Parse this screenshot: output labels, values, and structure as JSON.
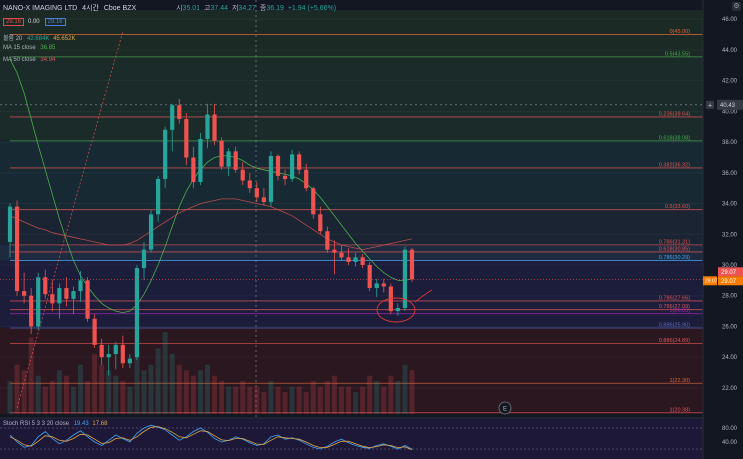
{
  "header": {
    "symbol": "NANO-X IMAGING LTD",
    "interval": "4시간",
    "exchange": "Cboe BZX",
    "ohlc": {
      "open_label": "시",
      "open": "35.01",
      "high_label": "고",
      "high": "37.44",
      "low_label": "저",
      "low": "34.27",
      "close_label": "종",
      "close": "36.19",
      "change": "+1.94 (+5.66%)"
    },
    "price_box_left": "29.16",
    "price_mid": "0.00",
    "price_box_right": "29.16"
  },
  "indicators": {
    "volume": {
      "label": "볼륨 20",
      "v1": "42.684K",
      "v2": "45.652K"
    },
    "ma15": {
      "label": "MA 15 close",
      "value": "36.85"
    },
    "ma50": {
      "label": "MA 50 close",
      "value": "34.94"
    },
    "rsi": {
      "label": "Stoch RSI 5 3 3 20 close",
      "k": "19.43",
      "d": "17.68"
    }
  },
  "axis": {
    "ticks": [
      {
        "v": 46,
        "t": "46.00"
      },
      {
        "v": 44,
        "t": "44.00"
      },
      {
        "v": 42,
        "t": "42.00"
      },
      {
        "v": 40,
        "t": "40.00"
      },
      {
        "v": 38,
        "t": "38.00"
      },
      {
        "v": 36,
        "t": "36.00"
      },
      {
        "v": 34,
        "t": "34.00"
      },
      {
        "v": 32,
        "t": "32.00"
      },
      {
        "v": 30,
        "t": "30.00"
      },
      {
        "v": 28,
        "t": "28.00"
      },
      {
        "v": 26,
        "t": "26.00"
      },
      {
        "v": 24,
        "t": "24.00"
      },
      {
        "v": 22,
        "t": "22.00"
      }
    ],
    "crosshair_label": "40.43",
    "last_price_label": "29.07",
    "last_price_sub": "29.07",
    "last_price_tag": "29.07",
    "rsi_ticks": [
      {
        "v": 80,
        "t": "80.00"
      },
      {
        "v": 40,
        "t": "40.00"
      }
    ]
  },
  "fib_levels": [
    {
      "label": "0(45.00)",
      "v": 45.0,
      "color": "#e0663c"
    },
    {
      "label": "0.5(43.55)",
      "v": 43.55,
      "color": "#4caf50"
    },
    {
      "label": "0.236(39.64)",
      "v": 39.64,
      "color": "#e05555"
    },
    {
      "label": "0.618(38.08)",
      "v": 38.08,
      "color": "#4caf50"
    },
    {
      "label": "0.382(36.32)",
      "v": 36.32,
      "color": "#e05555"
    },
    {
      "label": "0.5(33.60)",
      "v": 33.6,
      "color": "#e05555"
    },
    {
      "label": "0.786(31.31)",
      "v": 31.31,
      "color": "#e05555"
    },
    {
      "label": "0.618(30.85)",
      "v": 30.85,
      "color": "#e05555"
    },
    {
      "label": "0.786(30.29)",
      "v": 30.29,
      "color": "#42a5f5"
    },
    {
      "label": "0.786(27.66)",
      "v": 27.66,
      "color": "#e05555"
    },
    {
      "label": "0.786(27.09)",
      "v": 27.09,
      "color": "#e05555"
    },
    {
      "label": "1(26.83)",
      "v": 26.83,
      "color": "#9c27b0"
    },
    {
      "label": "0.886(25.90)",
      "v": 25.9,
      "color": "#5c6bc0"
    },
    {
      "label": "0.886(24.89)",
      "v": 24.89,
      "color": "#e05555"
    },
    {
      "label": "1(22.30)",
      "v": 22.3,
      "color": "#e0663c"
    },
    {
      "label": "1(20.38)",
      "v": 20.38,
      "color": "#e05555"
    }
  ],
  "chart_data": {
    "type": "candlestick",
    "ylim": [
      20.3,
      46.6
    ],
    "candles": [
      [
        31.5,
        34.0,
        30.5,
        33.8
      ],
      [
        33.8,
        34.2,
        28.0,
        28.3
      ],
      [
        28.3,
        29.5,
        27.5,
        28.0
      ],
      [
        28.0,
        28.5,
        25.5,
        26.0
      ],
      [
        26.0,
        29.5,
        25.8,
        29.2
      ],
      [
        29.2,
        29.7,
        27.8,
        28.1
      ],
      [
        28.1,
        29.0,
        27.0,
        27.5
      ],
      [
        27.5,
        28.8,
        26.5,
        28.5
      ],
      [
        28.5,
        29.2,
        27.3,
        27.8
      ],
      [
        27.8,
        28.6,
        26.8,
        28.3
      ],
      [
        28.3,
        29.6,
        27.6,
        29.0
      ],
      [
        29.0,
        29.2,
        26.3,
        26.5
      ],
      [
        26.5,
        26.8,
        24.6,
        24.8
      ],
      [
        24.8,
        25.2,
        23.5,
        24.0
      ],
      [
        24.0,
        24.8,
        22.8,
        24.2
      ],
      [
        24.2,
        25.0,
        23.2,
        24.8
      ],
      [
        24.8,
        25.4,
        23.3,
        23.6
      ],
      [
        23.6,
        24.2,
        23.3,
        23.9
      ],
      [
        24.0,
        30.0,
        23.8,
        29.8
      ],
      [
        29.8,
        31.5,
        29.0,
        31.0
      ],
      [
        31.0,
        33.6,
        30.8,
        33.3
      ],
      [
        33.3,
        35.8,
        32.8,
        35.6
      ],
      [
        35.6,
        39.0,
        35.0,
        38.8
      ],
      [
        38.8,
        40.5,
        37.4,
        40.4
      ],
      [
        40.4,
        40.8,
        39.2,
        39.5
      ],
      [
        39.5,
        39.9,
        36.5,
        37.0
      ],
      [
        37.0,
        37.7,
        35.0,
        35.4
      ],
      [
        35.4,
        38.6,
        35.2,
        38.2
      ],
      [
        38.2,
        40.5,
        37.6,
        39.8
      ],
      [
        39.8,
        40.5,
        37.8,
        38.1
      ],
      [
        38.1,
        38.3,
        36.2,
        36.4
      ],
      [
        36.4,
        37.6,
        35.8,
        37.4
      ],
      [
        37.4,
        37.7,
        36.0,
        36.2
      ],
      [
        36.2,
        36.7,
        35.2,
        35.5
      ],
      [
        35.5,
        36.0,
        34.7,
        35.0
      ],
      [
        35.0,
        35.4,
        34.1,
        34.4
      ],
      [
        34.4,
        35.0,
        33.9,
        34.1
      ],
      [
        34.1,
        37.4,
        33.8,
        37.1
      ],
      [
        37.1,
        37.2,
        35.5,
        35.8
      ],
      [
        35.8,
        36.2,
        35.2,
        35.6
      ],
      [
        35.6,
        37.5,
        35.4,
        37.2
      ],
      [
        37.2,
        37.4,
        35.9,
        36.2
      ],
      [
        36.2,
        36.6,
        34.8,
        35.0
      ],
      [
        35.0,
        35.1,
        33.0,
        33.3
      ],
      [
        33.3,
        33.8,
        32.0,
        32.2
      ],
      [
        32.2,
        32.5,
        30.8,
        31.0
      ],
      [
        31.0,
        31.6,
        29.4,
        30.8
      ],
      [
        30.8,
        31.3,
        30.3,
        30.5
      ],
      [
        30.5,
        31.1,
        30.0,
        30.2
      ],
      [
        30.2,
        30.8,
        29.9,
        30.5
      ],
      [
        30.5,
        30.7,
        29.8,
        30.0
      ],
      [
        30.0,
        30.2,
        28.3,
        28.5
      ],
      [
        28.5,
        29.1,
        27.9,
        28.8
      ],
      [
        28.8,
        29.1,
        28.2,
        28.6
      ],
      [
        28.6,
        28.8,
        26.8,
        27.0
      ],
      [
        27.0,
        27.5,
        26.7,
        27.2
      ],
      [
        27.2,
        31.2,
        27.0,
        31.0
      ],
      [
        31.0,
        31.1,
        28.9,
        29.07
      ]
    ],
    "ma15": [
      43.4,
      42.5,
      41.2,
      39.5,
      37.8,
      36.2,
      34.6,
      33.0,
      31.6,
      30.3,
      29.3,
      28.6,
      28.0,
      27.5,
      27.2,
      27.0,
      26.9,
      27.0,
      27.4,
      28.1,
      29.0,
      30.0,
      31.2,
      32.5,
      33.8,
      34.8,
      35.6,
      36.2,
      36.7,
      37.0,
      37.1,
      37.1,
      37.0,
      36.8,
      36.5,
      36.3,
      36.2,
      36.1,
      36.0,
      35.9,
      35.8,
      35.6,
      35.3,
      34.9,
      34.4,
      33.8,
      33.2,
      32.6,
      32.0,
      31.4,
      30.9,
      30.4,
      29.9,
      29.5,
      29.2,
      29.0,
      29.0,
      29.1
    ],
    "ma50": [
      33.2,
      33.0,
      32.8,
      32.6,
      32.4,
      32.3,
      32.1,
      32.0,
      31.9,
      31.8,
      31.7,
      31.6,
      31.5,
      31.4,
      31.3,
      31.3,
      31.3,
      31.4,
      31.6,
      31.9,
      32.2,
      32.5,
      32.8,
      33.1,
      33.4,
      33.6,
      33.8,
      34.0,
      34.1,
      34.2,
      34.3,
      34.3,
      34.3,
      34.2,
      34.1,
      34.0,
      33.9,
      33.8,
      33.6,
      33.4,
      33.2,
      32.9,
      32.6,
      32.3,
      32.0,
      31.7,
      31.5,
      31.3,
      31.2,
      31.1,
      31.0,
      31.1,
      31.2,
      31.3,
      31.4,
      31.5,
      31.6,
      31.7
    ],
    "volume": [
      0.6,
      0.9,
      0.8,
      1.4,
      0.7,
      0.5,
      0.6,
      0.8,
      0.7,
      0.5,
      0.9,
      0.6,
      1.1,
      0.9,
      0.8,
      0.7,
      0.6,
      0.5,
      1.3,
      0.8,
      0.9,
      1.2,
      1.5,
      1.1,
      0.9,
      0.8,
      0.7,
      0.8,
      0.9,
      0.7,
      0.6,
      0.5,
      0.5,
      0.6,
      0.5,
      0.5,
      0.4,
      0.6,
      0.5,
      0.4,
      0.5,
      0.5,
      0.4,
      0.6,
      0.5,
      0.6,
      0.7,
      0.5,
      0.5,
      0.4,
      0.5,
      0.7,
      0.6,
      0.5,
      0.7,
      0.6,
      0.9,
      0.8
    ],
    "stoch_k": [
      60,
      40,
      25,
      30,
      55,
      70,
      50,
      35,
      45,
      60,
      72,
      55,
      40,
      30,
      45,
      60,
      50,
      40,
      65,
      80,
      88,
      82,
      75,
      60,
      45,
      55,
      70,
      80,
      68,
      50,
      40,
      45,
      55,
      48,
      38,
      30,
      35,
      55,
      60,
      48,
      52,
      45,
      35,
      25,
      20,
      28,
      40,
      48,
      38,
      30,
      25,
      22,
      30,
      35,
      28,
      20,
      30,
      19.43
    ],
    "stoch_d": [
      55,
      45,
      32,
      28,
      42,
      58,
      55,
      45,
      42,
      50,
      62,
      60,
      48,
      36,
      38,
      50,
      52,
      45,
      55,
      70,
      82,
      84,
      78,
      68,
      55,
      52,
      62,
      72,
      70,
      58,
      46,
      44,
      50,
      50,
      42,
      34,
      33,
      45,
      55,
      52,
      50,
      48,
      40,
      30,
      24,
      25,
      33,
      42,
      42,
      35,
      28,
      24,
      27,
      32,
      30,
      24,
      26,
      17.68
    ]
  }
}
